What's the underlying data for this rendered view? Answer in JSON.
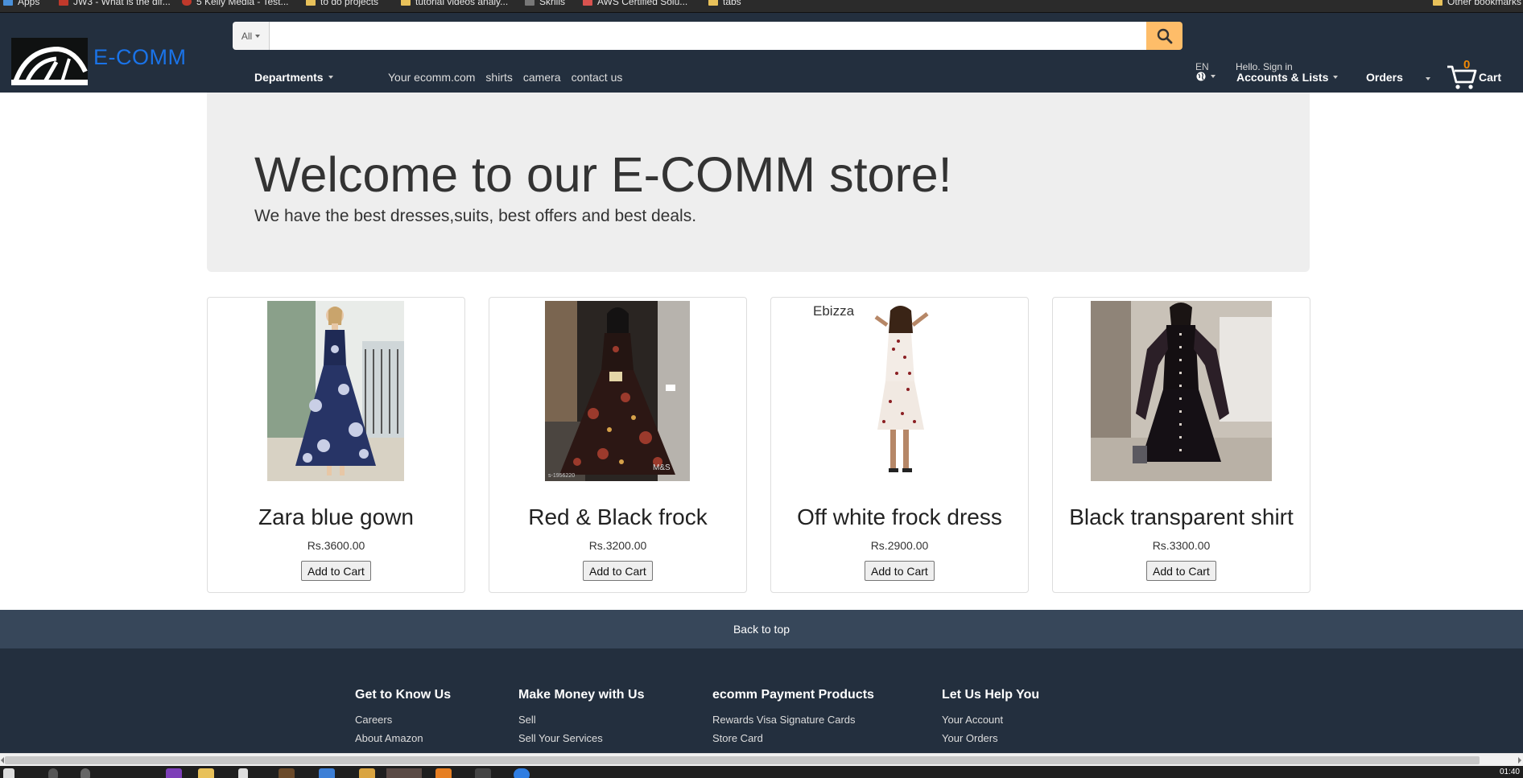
{
  "bookmarks": [
    {
      "label": "Apps"
    },
    {
      "label": "JW3 - What is the dif..."
    },
    {
      "label": "5 Kelly Media - Test..."
    },
    {
      "label": "to do projects"
    },
    {
      "label": "tutorial videos analy..."
    },
    {
      "label": "Skrills"
    },
    {
      "label": "AWS Certified Solu..."
    },
    {
      "label": "tabs"
    },
    {
      "label": "Other bookmarks"
    }
  ],
  "header": {
    "logo_text": "E-COMM",
    "search": {
      "category": "All",
      "value": "",
      "placeholder": ""
    },
    "departments_label": "Departments",
    "nav_links": [
      "Your ecomm.com",
      "shirts",
      "camera",
      "contact us"
    ],
    "language": "EN",
    "hello_text": "Hello. Sign in",
    "accounts_label": "Accounts & Lists",
    "orders_label": "Orders",
    "cart_count": "0",
    "cart_label": "Cart"
  },
  "jumbotron": {
    "title": "Welcome to our E-COMM store!",
    "subtitle": "We have the best dresses,suits, best offers and best deals."
  },
  "products": [
    {
      "title": "Zara blue gown",
      "price": "Rs.3600.00",
      "button": "Add to Cart"
    },
    {
      "title": "Red & Black frock",
      "price": "Rs.3200.00",
      "button": "Add to Cart"
    },
    {
      "title": "Off white frock dress",
      "price": "Rs.2900.00",
      "button": "Add to Cart",
      "brand": "Ebizza"
    },
    {
      "title": "Black transparent shirt",
      "price": "Rs.3300.00",
      "button": "Add to Cart"
    }
  ],
  "back_to_top": "Back to top",
  "footer": {
    "columns": [
      {
        "heading": "Get to Know Us",
        "links": [
          "Careers",
          "About Amazon"
        ]
      },
      {
        "heading": "Make Money with Us",
        "links": [
          "Sell",
          "Sell Your Services"
        ]
      },
      {
        "heading": "ecomm Payment Products",
        "links": [
          "Rewards Visa Signature Cards",
          "Store Card"
        ]
      },
      {
        "heading": "Let Us Help You",
        "links": [
          "Your Account",
          "Your Orders"
        ]
      }
    ]
  },
  "taskbar": {
    "clock": "01:40"
  },
  "colors": {
    "header_bg": "#232f3e",
    "search_button": "#febd69",
    "logo_text": "#1a73e8",
    "cart_count": "#f08804",
    "back_to_top_bg": "#37475a"
  }
}
